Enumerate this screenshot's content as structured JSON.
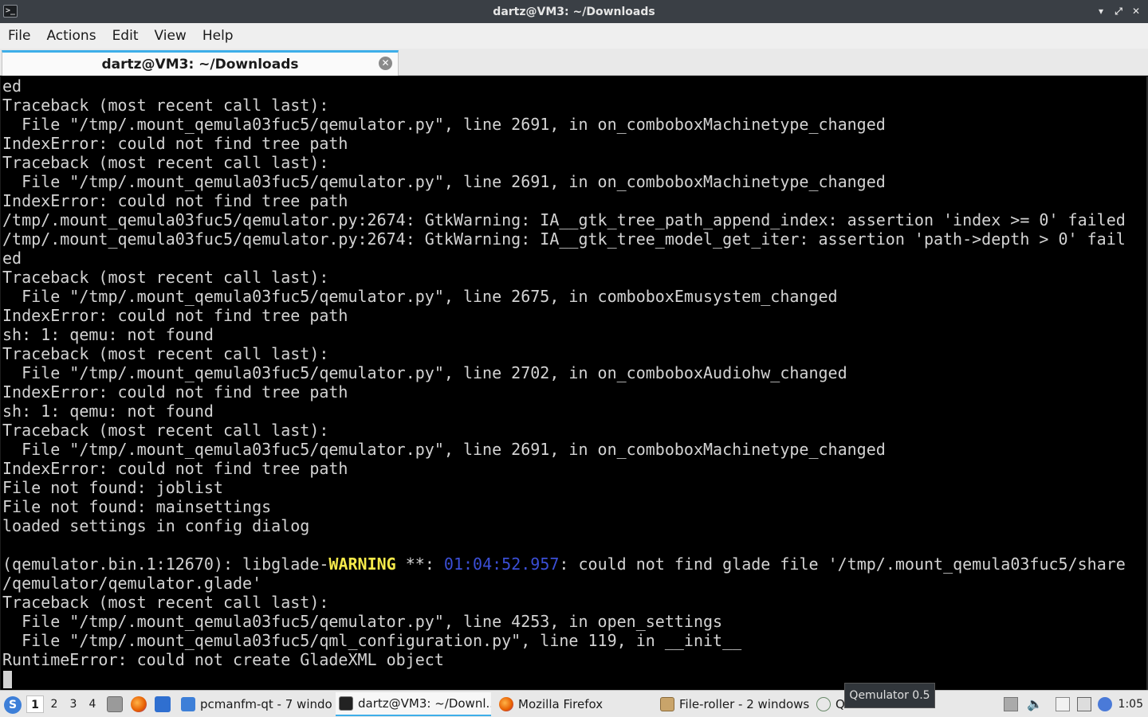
{
  "window": {
    "title": "dartz@VM3: ~/Downloads",
    "minimize": "▾",
    "maximize": "⤢",
    "close": "✕"
  },
  "menu": {
    "items": [
      "File",
      "Actions",
      "Edit",
      "View",
      "Help"
    ]
  },
  "tab": {
    "label": "dartz@VM3: ~/Downloads",
    "close": "✕"
  },
  "terminal": {
    "lines": [
      "ed",
      "Traceback (most recent call last):",
      "  File \"/tmp/.mount_qemula03fuc5/qemulator.py\", line 2691, in on_comboboxMachinetype_changed",
      "IndexError: could not find tree path",
      "Traceback (most recent call last):",
      "  File \"/tmp/.mount_qemula03fuc5/qemulator.py\", line 2691, in on_comboboxMachinetype_changed",
      "IndexError: could not find tree path",
      "/tmp/.mount_qemula03fuc5/qemulator.py:2674: GtkWarning: IA__gtk_tree_path_append_index: assertion 'index >= 0' failed",
      "/tmp/.mount_qemula03fuc5/qemulator.py:2674: GtkWarning: IA__gtk_tree_model_get_iter: assertion 'path->depth > 0' fail",
      "ed",
      "Traceback (most recent call last):",
      "  File \"/tmp/.mount_qemula03fuc5/qemulator.py\", line 2675, in comboboxEmusystem_changed",
      "IndexError: could not find tree path",
      "sh: 1: qemu: not found",
      "Traceback (most recent call last):",
      "  File \"/tmp/.mount_qemula03fuc5/qemulator.py\", line 2702, in on_comboboxAudiohw_changed",
      "IndexError: could not find tree path",
      "sh: 1: qemu: not found",
      "Traceback (most recent call last):",
      "  File \"/tmp/.mount_qemula03fuc5/qemulator.py\", line 2691, in on_comboboxMachinetype_changed",
      "IndexError: could not find tree path",
      "File not found: joblist",
      "File not found: mainsettings",
      "loaded settings in config dialog",
      "",
      "",
      "/qemulator/qemulator.glade'",
      "Traceback (most recent call last):",
      "  File \"/tmp/.mount_qemula03fuc5/qemulator.py\", line 4253, in open_settings",
      "  File \"/tmp/.mount_qemula03fuc5/qml_configuration.py\", line 119, in __init__",
      "RuntimeError: could not create GladeXML object"
    ],
    "warning_line": {
      "prefix": "(qemulator.bin.1:12670): libglade-",
      "warn": "WARNING",
      "mid": " **: ",
      "time": "01:04:52.957",
      "suffix": ": could not find glade file '/tmp/.mount_qemula03fuc5/share"
    },
    "colors": {
      "text": "#d3d3d3",
      "warning": "#f5e94a",
      "timestamp": "#3b4fd6"
    }
  },
  "taskbar": {
    "desktops": [
      "1",
      "2",
      "3",
      "4"
    ],
    "tasks": [
      {
        "label": "pcmanfm-qt - 7 windo...",
        "icon": "folder-icon"
      },
      {
        "label": "dartz@VM3: ~/Downl...",
        "icon": "terminal-icon"
      },
      {
        "label": "Mozilla Firefox",
        "icon": "firefox-icon"
      },
      {
        "label": "File-roller - 2 windows",
        "icon": "archive-icon"
      },
      {
        "label": "Qe",
        "icon": "qemulator-icon"
      }
    ],
    "tooltip": "Qemulator 0.5",
    "clock": "1:05"
  }
}
